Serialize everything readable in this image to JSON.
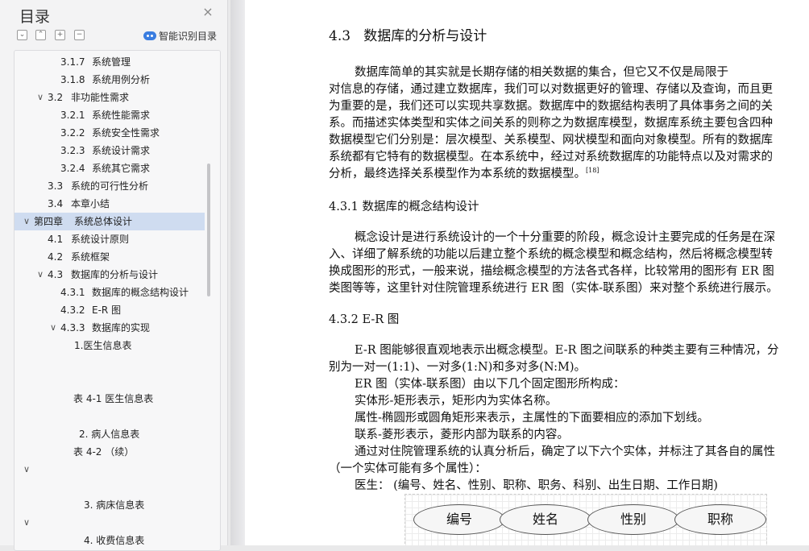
{
  "sidebar": {
    "title": "目录",
    "close_icon": "×",
    "smart_label": "智能识别目录",
    "toc": [
      {
        "num": "3.1.7",
        "label": "系统管理"
      },
      {
        "num": "3.1.8",
        "label": "系统用例分析"
      },
      {
        "num": "3.2",
        "label": "非功能性需求"
      },
      {
        "num": "3.2.1",
        "label": "系统性能需求"
      },
      {
        "num": "3.2.2",
        "label": "系统安全性需求"
      },
      {
        "num": "3.2.3",
        "label": "系统设计需求"
      },
      {
        "num": "3.2.4",
        "label": "系统其它需求"
      },
      {
        "num": "3.3",
        "label": "系统的可行性分析"
      },
      {
        "num": "3.4",
        "label": "本章小结"
      },
      {
        "num": "第四章",
        "label": "系统总体设计"
      },
      {
        "num": "4.1",
        "label": "系统设计原则"
      },
      {
        "num": "4.2",
        "label": "系统框架"
      },
      {
        "num": "4.3",
        "label": "数据库的分析与设计"
      },
      {
        "num": "4.3.1",
        "label": "数据库的概念结构设计"
      },
      {
        "num": "4.3.2",
        "label": "E-R 图"
      },
      {
        "num": "4.3.3",
        "label": "数据库的实现"
      },
      {
        "num": "",
        "label": "1.医生信息表"
      },
      {
        "num": "",
        "label": "表 4-1  医生信息表"
      },
      {
        "num": "",
        "label": "2. 病人信息表"
      },
      {
        "num": "",
        "label": "表 4-2 （续）"
      },
      {
        "num": "",
        "label": "3. 病床信息表"
      },
      {
        "num": "",
        "label": "4. 收费信息表"
      }
    ]
  },
  "document": {
    "heading_43_num": "4.3",
    "heading_43_text": "数据库的分析与设计",
    "para1": [
      "数据库简单的其实就是长期存储的相关数据的集合，但它又不仅是局限于",
      "对信息的存储，通过建立数据库，我们可以对数据更好的管理、存储以及查询，而且更",
      "为重要的是，我们还可以实现共享数据。数据库中的数据结构表明了具体事务之间的关",
      "系。而描述实体类型和实体之间关系的则称之为数据库模型，数据库系统主要包含四种",
      "数据模型它们分别是：层次模型、关系模型、网状模型和面向对象模型。所有的数据库",
      "系统都有它特有的数据模型。在本系统中，经过对系统数据库的功能特点以及对需求的",
      "分析，最终选择关系模型作为本系统的数据模型。"
    ],
    "citation": "[18]",
    "heading_431": "4.3.1   数据库的概念结构设计",
    "para2": [
      "概念设计是进行系统设计的一个十分重要的阶段，概念设计主要完成的任务是在深",
      "入、详细了解系统的功能以后建立整个系统的概念模型和概念结构，然后将概念模型转",
      "换成图形的形式，一般来说，描绘概念模型的方法各式各样，比较常用的图形有 ER 图",
      "类图等等，这里针对住院管理系统进行 ER 图（实体-联系图）来对整个系统进行展示。"
    ],
    "heading_432": "4.3.2   E-R 图",
    "para3": [
      "E-R 图能够很直观地表示出概念模型。E-R 图之间联系的种类主要有三种情况，分",
      "别为一对一(1:1)、一对多(1:N)和多对多(N:M)。",
      "ER 图（实体-联系图）由以下几个固定图形所构成：",
      "实体形-矩形表示，矩形内为实体名称。",
      "属性-椭圆形或圆角矩形来表示，主属性的下面要相应的添加下划线。",
      "联系-菱形表示，菱形内部为联系的内容。",
      "通过对住院管理系统的认真分析后，确定了以下六个实体，并标注了其各自的属性",
      "（一个实体可能有多个属性）：",
      "医生：  (编号、姓名、性别、职称、职务、科别、出生日期、工作日期)"
    ],
    "er_attrs": [
      "编号",
      "姓名",
      "性别",
      "职称"
    ]
  }
}
